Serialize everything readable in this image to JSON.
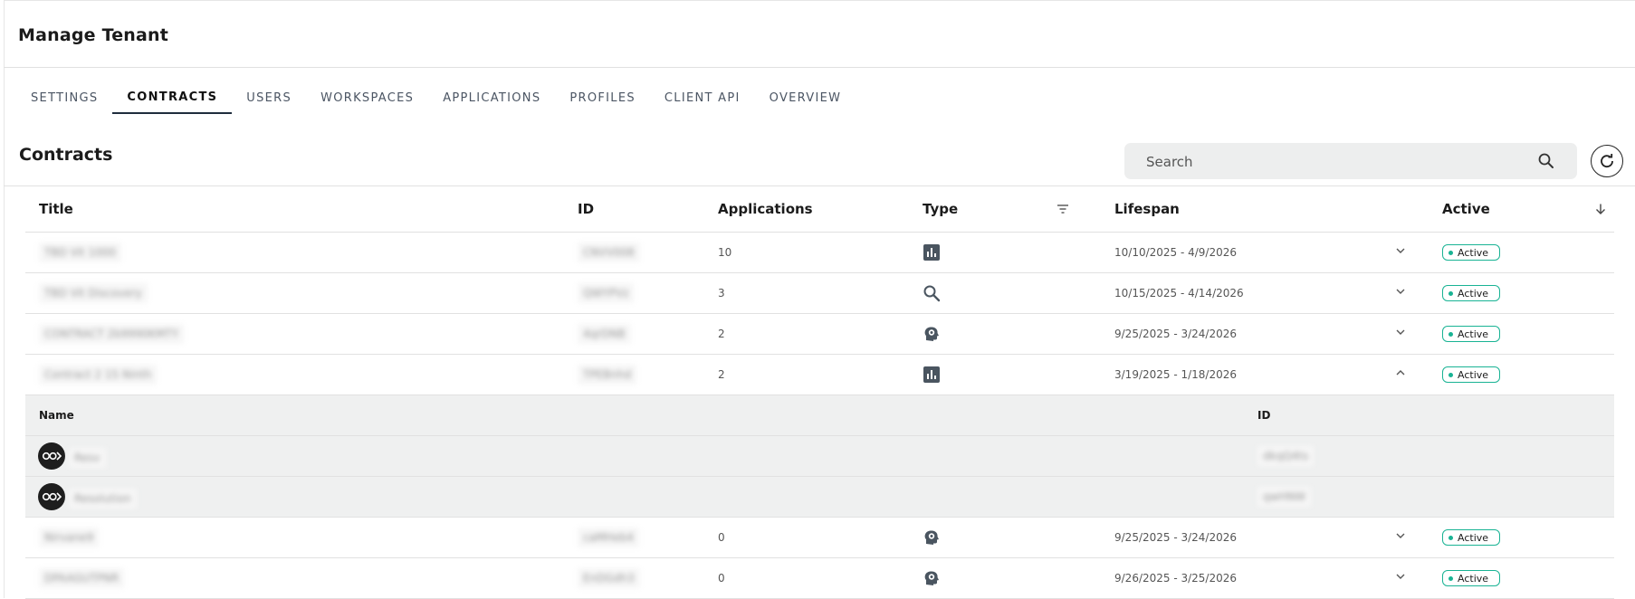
{
  "header": {
    "title": "Manage Tenant"
  },
  "tabs": [
    {
      "label": "SETTINGS",
      "active": false
    },
    {
      "label": "CONTRACTS",
      "active": true
    },
    {
      "label": "USERS",
      "active": false
    },
    {
      "label": "WORKSPACES",
      "active": false
    },
    {
      "label": "APPLICATIONS",
      "active": false
    },
    {
      "label": "PROFILES",
      "active": false
    },
    {
      "label": "CLIENT API",
      "active": false
    },
    {
      "label": "OVERVIEW",
      "active": false
    }
  ],
  "contracts": {
    "title": "Contracts",
    "search": {
      "placeholder": "Search",
      "value": ""
    },
    "columns": {
      "title": "Title",
      "id": "ID",
      "applications": "Applications",
      "type": "Type",
      "lifespan": "Lifespan",
      "active": "Active"
    },
    "rows": [
      {
        "title": "TBD Vit 1000",
        "id": "CNVV008",
        "applications": "10",
        "type_icon": "bar-chart-icon",
        "lifespan": "10/10/2025 - 4/9/2026",
        "active": "Active",
        "expanded": false
      },
      {
        "title": "TBD Vit Discovery",
        "id": "QWYPVz",
        "applications": "3",
        "type_icon": "magnifier-icon",
        "lifespan": "10/15/2025 - 4/14/2026",
        "active": "Active",
        "expanded": false
      },
      {
        "title": "CONTRACT 2b9990KMTY",
        "id": "4qrDNB",
        "applications": "2",
        "type_icon": "head-gear-icon",
        "lifespan": "9/25/2025 - 3/24/2026",
        "active": "Active",
        "expanded": false
      },
      {
        "title": "Contract 2 15 Ninth",
        "id": "TPEBnhd",
        "applications": "2",
        "type_icon": "bar-chart-icon",
        "lifespan": "3/19/2025 - 1/18/2026",
        "active": "Active",
        "expanded": true
      },
      {
        "title": "Nirvane9",
        "id": "caMHeb4",
        "applications": "0",
        "type_icon": "head-gear-icon",
        "lifespan": "9/25/2025 - 3/24/2026",
        "active": "Active",
        "expanded": false
      },
      {
        "title": "DPAAGUTPNR",
        "id": "EnDGdh3",
        "applications": "0",
        "type_icon": "head-gear-icon",
        "lifespan": "9/26/2025 - 3/25/2026",
        "active": "Active",
        "expanded": false
      }
    ],
    "sub": {
      "columns": {
        "name": "Name",
        "id": "ID"
      },
      "rows": [
        {
          "name": "Resv",
          "id": "dkqQ4ts"
        },
        {
          "name": "Resolution",
          "id": "qwHNW"
        }
      ]
    }
  },
  "colors": {
    "accent": "#19b394",
    "tab_underline": "#1f2d3d",
    "subtable_bg": "#eff0f0",
    "search_bg": "#edeeee"
  }
}
